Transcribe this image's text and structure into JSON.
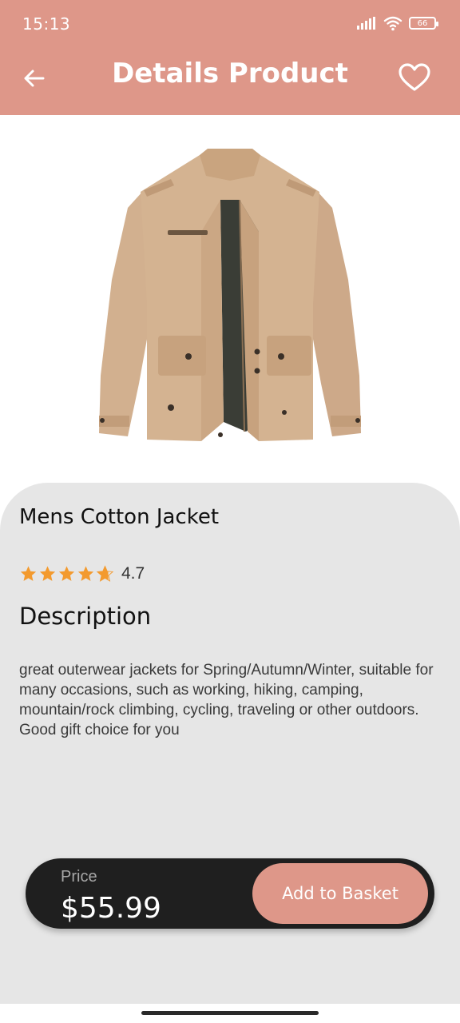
{
  "status_bar": {
    "time": "15:13",
    "battery": "66"
  },
  "header": {
    "title": "Details Product",
    "back_icon": "arrow-left-icon",
    "favorite_icon": "heart-outline-icon"
  },
  "product": {
    "name": "Mens Cotton Jacket",
    "image_icon": "jacket-image",
    "rating": "4.7",
    "rating_stars": 4.7,
    "description_title": "Description",
    "description": "great outerwear jackets for Spring/Autumn/Winter, suitable for many occasions, such as working, hiking, camping, mountain/rock climbing, cycling, traveling or other outdoors. Good gift choice for you"
  },
  "buy_bar": {
    "price_label": "Price",
    "price": "$55.99",
    "add_button_label": "Add to Basket"
  },
  "colors": {
    "accent": "#DE9789",
    "card_bg": "#E6E6E6",
    "bar_bg": "#1F1F1F",
    "star": "#F39A2E"
  }
}
